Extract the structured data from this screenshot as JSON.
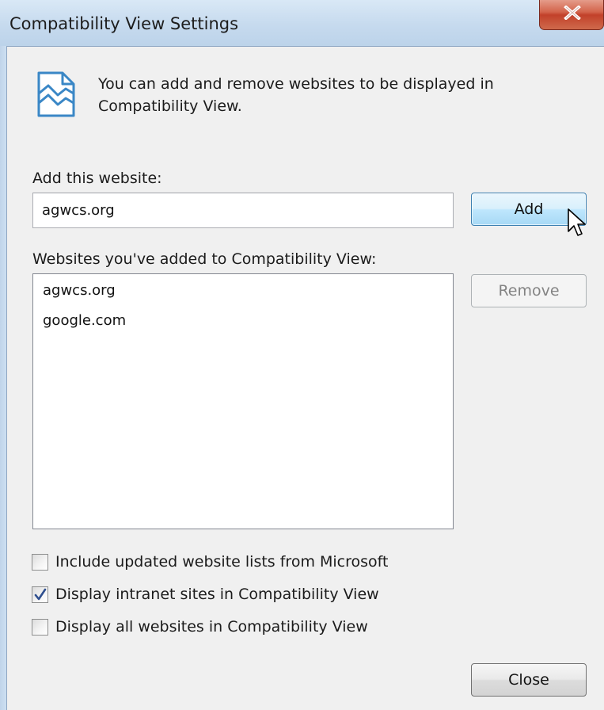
{
  "window": {
    "title": "Compatibility View Settings",
    "close_icon": "close-x-icon"
  },
  "info": {
    "icon": "broken-page-icon",
    "text": "You can add and remove websites to be displayed in Compatibility View."
  },
  "add_section": {
    "label": "Add this website:",
    "input_value": "agwcs.org",
    "add_button_label": "Add"
  },
  "list_section": {
    "label": "Websites you've added to Compatibility View:",
    "items": [
      "agwcs.org",
      "google.com"
    ],
    "remove_button_label": "Remove"
  },
  "options": [
    {
      "label": "Include updated website lists from Microsoft",
      "checked": false
    },
    {
      "label": "Display intranet sites in Compatibility View",
      "checked": true
    },
    {
      "label": "Display all websites in Compatibility View",
      "checked": false
    }
  ],
  "footer": {
    "close_button_label": "Close"
  },
  "colors": {
    "frame": "#c9dcef",
    "client": "#f0f0f0",
    "hover_border": "#3c7fb1",
    "close_red": "#c2412a",
    "check_mark": "#2f4f8f"
  }
}
